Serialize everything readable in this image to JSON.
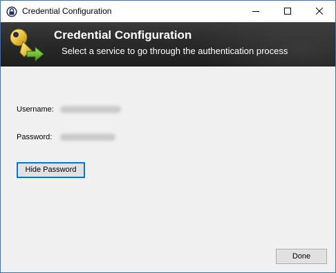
{
  "window": {
    "title": "Credential Configuration",
    "icons": {
      "app": "lock-icon",
      "minimize": "minimize-icon",
      "maximize": "maximize-icon",
      "close": "close-icon"
    }
  },
  "banner": {
    "icon": "key-arrow-icon",
    "title": "Credential Configuration",
    "subtitle": "Select a service to go through the authentication process"
  },
  "form": {
    "username_label": "Username:",
    "password_label": "Password:"
  },
  "buttons": {
    "hide_password": "Hide Password",
    "done": "Done"
  },
  "colors": {
    "accent": "#0078d7",
    "window_border": "#2b77c2",
    "banner_bg": "#2a2a2a",
    "body_bg": "#f0f0f0"
  }
}
